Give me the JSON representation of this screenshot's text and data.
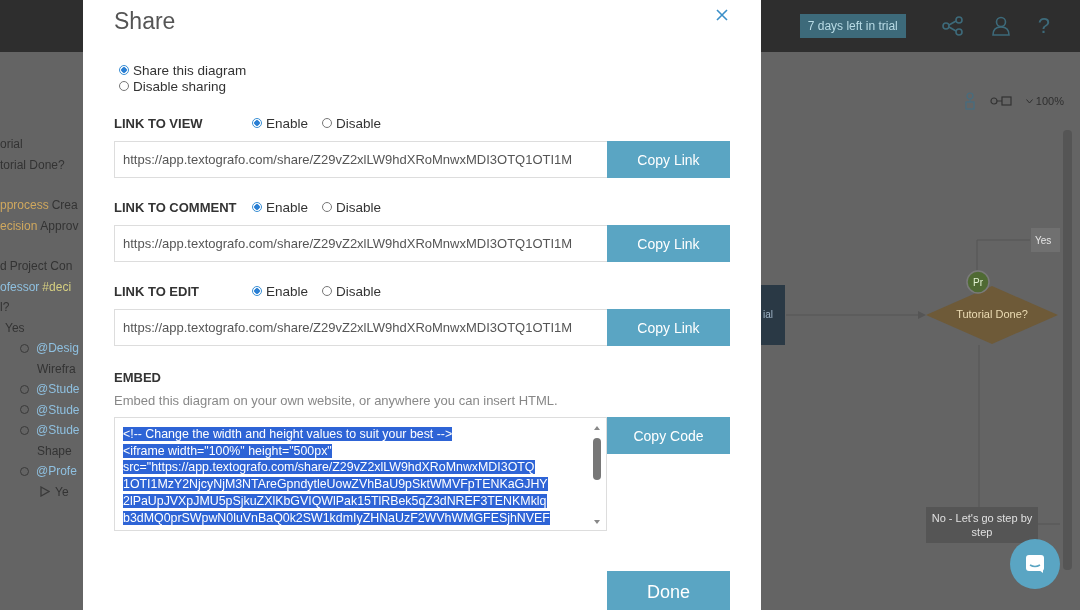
{
  "topbar": {
    "trial_badge": "7 days left in trial",
    "help_label": "?"
  },
  "outline": [
    {
      "parts": [
        {
          "text": "orial"
        }
      ]
    },
    {
      "parts": [
        {
          "text": "torial Done?"
        }
      ]
    },
    {
      "parts": [
        {
          "text": "pprocess",
          "color": "#d0a85e"
        },
        {
          "text": "Crea"
        }
      ]
    },
    {
      "parts": [
        {
          "text": "ecision",
          "color": "#d0a85e"
        },
        {
          "text": "Approv"
        }
      ]
    },
    {
      "parts": [
        {
          "text": "d"
        },
        {
          "text": "Project Con"
        }
      ]
    },
    {
      "parts": [
        {
          "text": "ofessor",
          "color": "#8fc0e0"
        },
        {
          "text": "#deci",
          "color": "#d6cf80"
        }
      ]
    },
    {
      "parts": [
        {
          "text": "l?"
        }
      ]
    },
    {
      "parts": [
        {
          "text": "Yes"
        }
      ],
      "children": [
        {
          "kind": "circle",
          "parts": [
            {
              "text": "@Desig",
              "color": "#8fc0e0"
            }
          ]
        },
        {
          "parts": [
            {
              "text": "Wirefra"
            }
          ]
        },
        {
          "kind": "circle",
          "parts": [
            {
              "text": "@Stude",
              "color": "#8fc0e0"
            }
          ]
        },
        {
          "kind": "circle",
          "parts": [
            {
              "text": "@Stude",
              "color": "#8fc0e0"
            }
          ]
        },
        {
          "kind": "circle",
          "parts": [
            {
              "text": "@Stude",
              "color": "#8fc0e0"
            }
          ]
        },
        {
          "parts": [
            {
              "text": "Shape"
            }
          ]
        },
        {
          "kind": "circle",
          "parts": [
            {
              "text": "@Profe",
              "color": "#8fc0e0"
            }
          ],
          "children": [
            {
              "kind": "triangle",
              "parts": [
                {
                  "text": "Ye"
                }
              ]
            }
          ]
        }
      ]
    }
  ],
  "canvas": {
    "zoom": "100%",
    "process_node": "ial",
    "decision_node": "Tutorial Done?",
    "avatar": "Pr",
    "yes_label": "Yes",
    "no_label": "No - Let's go step by step"
  },
  "dialog": {
    "title": "Share",
    "sharing": [
      {
        "label": "Share this diagram",
        "selected": true
      },
      {
        "label": "Disable sharing",
        "selected": false
      }
    ],
    "links": [
      {
        "heading": "LINK TO VIEW",
        "options": [
          {
            "label": "Enable",
            "selected": true
          },
          {
            "label": "Disable",
            "selected": false
          }
        ],
        "url": "https://app.textografo.com/share/Z29vZ2xlLW9hdXRoMnwxMDI3OTQ1OTI1M",
        "button": "Copy Link"
      },
      {
        "heading": "LINK TO COMMENT",
        "options": [
          {
            "label": "Enable",
            "selected": true
          },
          {
            "label": "Disable",
            "selected": false
          }
        ],
        "url": "https://app.textografo.com/share/Z29vZ2xlLW9hdXRoMnwxMDI3OTQ1OTI1M",
        "button": "Copy Link"
      },
      {
        "heading": "LINK TO EDIT",
        "options": [
          {
            "label": "Enable",
            "selected": true
          },
          {
            "label": "Disable",
            "selected": false
          }
        ],
        "url": "https://app.textografo.com/share/Z29vZ2xlLW9hdXRoMnwxMDI3OTQ1OTI1M",
        "button": "Copy Link"
      }
    ],
    "embed": {
      "heading": "EMBED",
      "description": "Embed this diagram on your own website, or anywhere you can insert HTML.",
      "selected": true,
      "button": "Copy Code",
      "code_lines": [
        "<!-- Change the width and height values to suit your best -->",
        "<iframe width=\"100%\" height=\"500px\"",
        "src=\"https://app.textografo.com/share/Z29vZ2xlLW9hdXRoMnwxMDI3OTQ",
        "1OTI1MzY2NjcyNjM3NTAreGpndytleUowZVhBaU9pSktWMVFpTENKaGJHY",
        "2lPaUpJVXpJMU5pSjkuZXlKbGVIQWlPak15TlRBek5qZ3dNREF3TENKMklq",
        "b3dMQ0prSWpwN0luVnBaQ0k2SW1kdmIyZHNaUzF2WVhWMGFESjhNVEF"
      ]
    },
    "done_button": "Done"
  }
}
